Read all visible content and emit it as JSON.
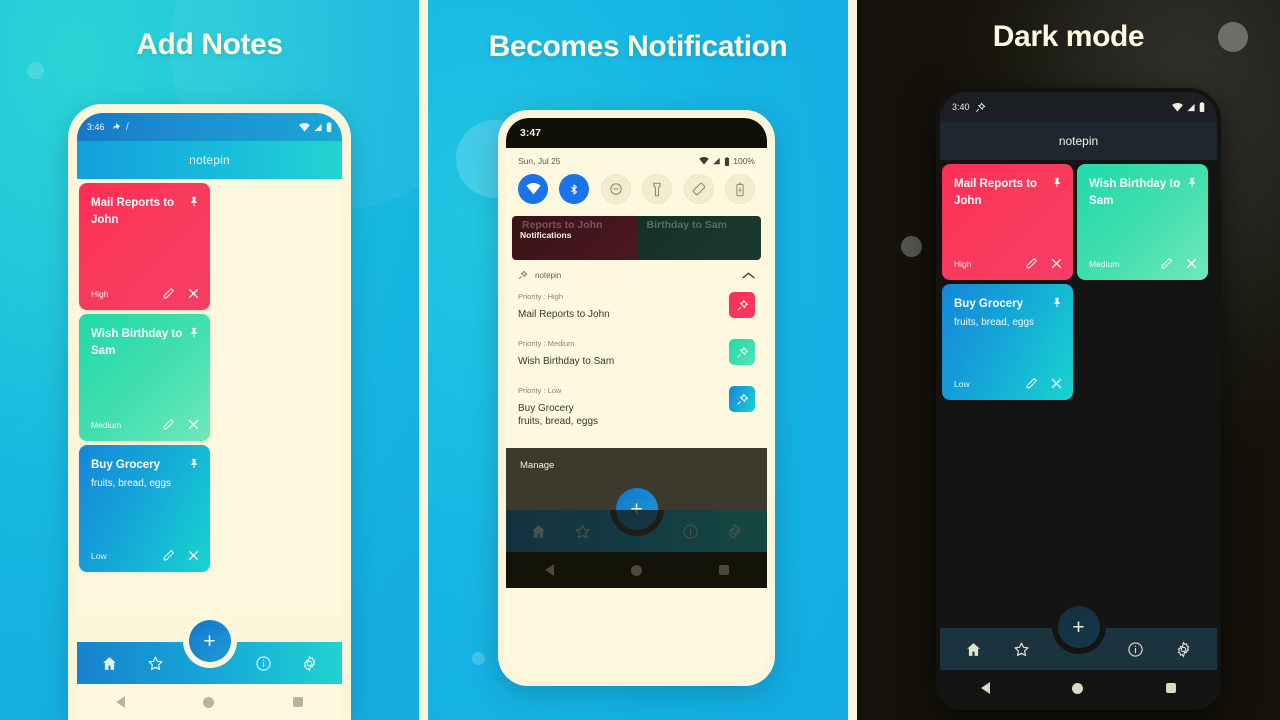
{
  "panels": [
    {
      "headline": "Add Notes",
      "statusbar": {
        "time": "3:46",
        "icons": [
          "pin-icon",
          "slash-icon",
          "wifi-icon",
          "signal-icon",
          "battery-icon"
        ]
      },
      "appbar": {
        "title": "notepin"
      },
      "notes": [
        {
          "title": "Mail Reports to John",
          "subtitle": "",
          "priority": "High",
          "color": "#FF2D55",
          "pin": "pin-icon",
          "edit": "pencil-icon",
          "delete": "close-icon"
        },
        {
          "title": "Wish Birthday to Sam",
          "subtitle": "",
          "priority": "Medium",
          "color": "#21D9A8",
          "pin": "pin-icon",
          "edit": "pencil-icon",
          "delete": "close-icon"
        },
        {
          "title": "Buy Grocery",
          "subtitle": "fruits, bread, eggs",
          "priority": "Low",
          "color": "#15A6D8",
          "pin": "pin-icon",
          "edit": "pencil-icon",
          "delete": "close-icon"
        }
      ],
      "fab": {
        "label": "+"
      },
      "nav": [
        {
          "name": "home-icon",
          "label": "Home"
        },
        {
          "name": "star-icon",
          "label": "Favourites"
        },
        {
          "name": "info-icon",
          "label": "Info"
        },
        {
          "name": "gear-icon",
          "label": "Settings"
        }
      ],
      "sysnav": [
        "back-icon",
        "home-circle-icon",
        "recents-icon"
      ]
    },
    {
      "headline": "Becomes Notification",
      "notch": {
        "time": "3:47"
      },
      "quicksettings": {
        "date": "Sun, Jul 25",
        "battery_percent": "100%",
        "tiles": [
          {
            "name": "wifi-tile",
            "on": true
          },
          {
            "name": "bluetooth-tile",
            "on": true
          },
          {
            "name": "dnd-tile",
            "on": false
          },
          {
            "name": "flashlight-tile",
            "on": false
          },
          {
            "name": "auto-rotate-tile",
            "on": false
          },
          {
            "name": "battery-saver-tile",
            "on": false
          }
        ]
      },
      "blurred_notes": {
        "label": "Notifications",
        "left_text": "Reports to John",
        "right_text": "Birthday to Sam"
      },
      "notification": {
        "app": "notepin",
        "collapse": "chevron-up-icon",
        "items": [
          {
            "priority": "Priority : High",
            "title": "Mail Reports to John",
            "subtitle": "",
            "badge": "#FF2D55"
          },
          {
            "priority": "Priority : Medium",
            "title": "Wish Birthday to Sam",
            "subtitle": "",
            "badge": "#21D9A8"
          },
          {
            "priority": "Priority : Low",
            "title": "Buy Grocery",
            "subtitle": "fruits, bread, eggs",
            "badge": "#15A6D8"
          }
        ]
      },
      "manage": {
        "label": "Manage"
      },
      "fab": {
        "label": "+"
      },
      "nav": [
        {
          "name": "home-icon",
          "label": "Home"
        },
        {
          "name": "star-icon",
          "label": "Favourites"
        },
        {
          "name": "info-icon",
          "label": "Info"
        },
        {
          "name": "gear-icon",
          "label": "Settings"
        }
      ],
      "sysnav": [
        "back-icon",
        "home-circle-icon",
        "recents-icon"
      ]
    },
    {
      "headline": "Dark mode",
      "statusbar": {
        "time": "3:40",
        "icons": [
          "pin-icon",
          "wifi-icon",
          "signal-icon",
          "battery-icon"
        ]
      },
      "appbar": {
        "title": "notepin"
      },
      "notes": [
        {
          "title": "Mail Reports to John",
          "subtitle": "",
          "priority": "High",
          "color": "#FF2D55",
          "pin": "pin-icon",
          "edit": "pencil-icon",
          "delete": "close-icon"
        },
        {
          "title": "Wish Birthday to Sam",
          "subtitle": "",
          "priority": "Medium",
          "color": "#21D9A8",
          "pin": "pin-icon",
          "edit": "pencil-icon",
          "delete": "close-icon"
        },
        {
          "title": "Buy Grocery",
          "subtitle": "fruits, bread, eggs",
          "priority": "Low",
          "color": "#15A6D8",
          "pin": "pin-icon",
          "edit": "pencil-icon",
          "delete": "close-icon"
        }
      ],
      "fab": {
        "label": "+"
      },
      "nav": [
        {
          "name": "home-icon",
          "label": "Home"
        },
        {
          "name": "star-icon",
          "label": "Favourites"
        },
        {
          "name": "info-icon",
          "label": "Info"
        },
        {
          "name": "gear-icon",
          "label": "Settings"
        }
      ],
      "sysnav": [
        "back-icon",
        "home-circle-icon",
        "recents-icon"
      ]
    }
  ],
  "colors": {
    "panel1_bg": "#1AC3DA",
    "panel2_bg": "#15B0E2",
    "panel3_bg": "#14120A",
    "cream": "#FDF8DE",
    "accent_red": "#FF2D55",
    "accent_green": "#21D9A8",
    "accent_blue": "#15A6D8",
    "headline_text": "#FDF8DF"
  }
}
